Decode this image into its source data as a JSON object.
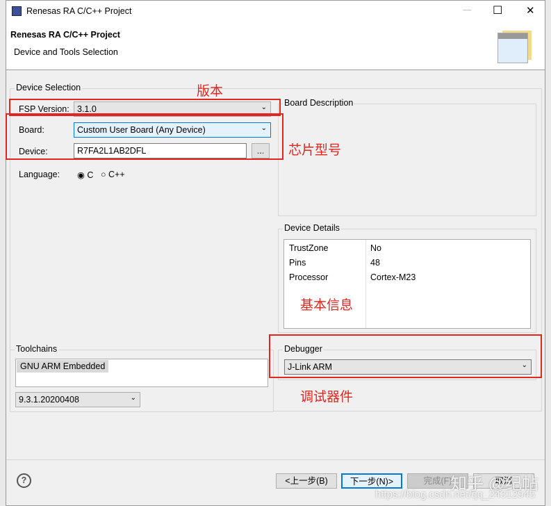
{
  "window": {
    "title": "Renesas RA C/C++ Project",
    "minimize": "—",
    "maximize": "☐",
    "close": "✕"
  },
  "header": {
    "title": "Renesas RA C/C++ Project",
    "subtitle": "Device and Tools Selection"
  },
  "device_selection": {
    "label": "Device Selection",
    "fsp_label": "FSP Version:",
    "fsp_value": "3.1.0",
    "board_label": "Board:",
    "board_value": "Custom User Board (Any Device)",
    "device_label": "Device:",
    "device_value": "R7FA2L1AB2DFL",
    "browse": "...",
    "language_label": "Language:",
    "lang_c": "C",
    "lang_cpp": "C++"
  },
  "board_description": {
    "label": "Board Description"
  },
  "device_details": {
    "label": "Device Details",
    "rows": [
      {
        "k": "TrustZone",
        "v": "No"
      },
      {
        "k": "Pins",
        "v": "48"
      },
      {
        "k": "Processor",
        "v": "Cortex-M23"
      }
    ]
  },
  "toolchains": {
    "label": "Toolchains",
    "item": "GNU ARM Embedded",
    "version": "9.3.1.20200408"
  },
  "debugger": {
    "label": "Debugger",
    "value": "J-Link ARM"
  },
  "annotations": {
    "version": "版本",
    "chip": "芯片型号",
    "info": "基本信息",
    "debugger": "调试器件"
  },
  "buttons": {
    "help": "?",
    "back": "<上一步(B)",
    "next": "下一步(N)>",
    "finish": "完成(F)",
    "cancel": "取消"
  },
  "watermark": {
    "site": "知乎 @纪帖",
    "url": "https://blog.csdn.net/qq_24312945"
  }
}
